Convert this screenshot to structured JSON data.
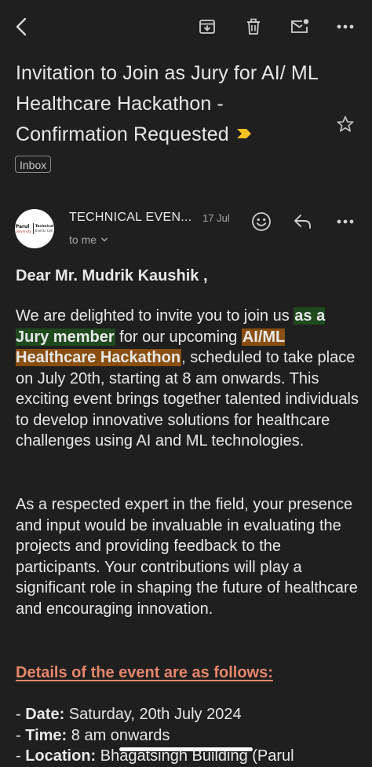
{
  "toolbar": {
    "back_icon": "chevron-left-icon",
    "archive_icon": "archive-icon",
    "delete_icon": "trash-icon",
    "mark_unread_icon": "mail-unread-icon",
    "more_icon": "more-horizontal-icon"
  },
  "email": {
    "subject": "Invitation to Join as Jury for AI/ ML Healthcare Hackathon - Confirmation Requested",
    "importance_marker_color": "#f6c21b",
    "label": "Inbox",
    "sender_avatar": {
      "line1": "Parul",
      "line2": "University",
      "line3": "Technical",
      "line4": "Events Cell"
    },
    "sender_name": "TECHNICAL EVEN...",
    "date": "17 Jul",
    "recipient": "to me",
    "greeting": "Dear Mr. Mudrik Kaushik ,",
    "para1": {
      "t1": "We are delighted to invite you to join us ",
      "h1": "as a Jury member",
      "t2": " for our upcoming ",
      "h2": "AI/ML Healthcare Hackathon",
      "t3": ", scheduled to take place on July 20th, starting at 8 am onwards. This exciting event brings together talented individuals to develop innovative solutions for healthcare challenges using AI and ML technologies."
    },
    "para2": "As a respected expert in the field, your presence and input would be invaluable in evaluating the projects and providing feedback to the participants. Your contributions will play a significant role in shaping the future of healthcare and encouraging innovation.",
    "details_heading": "Details of the event are as follows:",
    "details": [
      {
        "prefix": "- ",
        "key": "Date:",
        "value": " Saturday, 20th July 2024"
      },
      {
        "prefix": "- ",
        "key": "Time:",
        "value": " 8 am onwards"
      },
      {
        "prefix": "- ",
        "key": "Location:",
        "value": " Bhagatsingh Building (Parul"
      }
    ]
  },
  "colors": {
    "background": "#1f1f1f",
    "text": "#e8e8e8",
    "highlight_green": "#1e4a1e",
    "highlight_orange": "#8a4f0f",
    "link_heading": "#e8866a"
  }
}
